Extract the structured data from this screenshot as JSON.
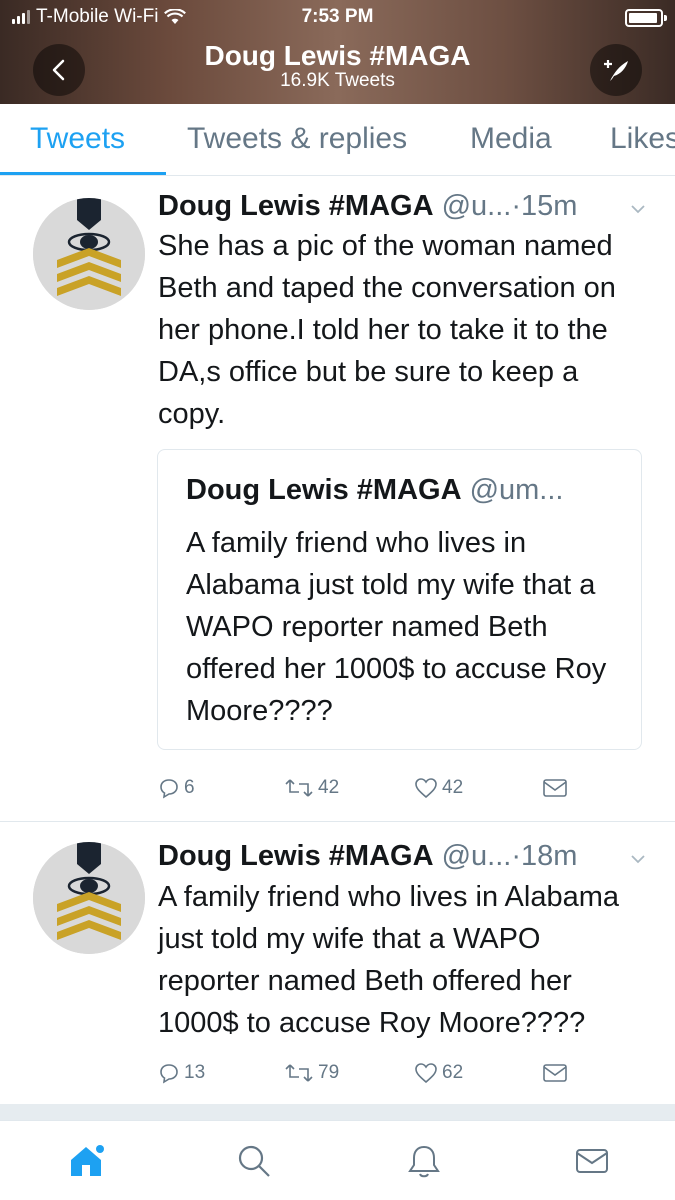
{
  "status_bar": {
    "carrier": "T-Mobile Wi-Fi",
    "time": "7:53 PM"
  },
  "header": {
    "title": "Doug Lewis #MAGA",
    "subtitle": "16.9K Tweets"
  },
  "tabs": [
    {
      "label": "Tweets",
      "active": true
    },
    {
      "label": "Tweets & replies",
      "active": false
    },
    {
      "label": "Media",
      "active": false
    },
    {
      "label": "Likes",
      "active": false
    }
  ],
  "tweets": [
    {
      "name": "Doug Lewis #MAGA",
      "handle": "@u...",
      "time": "15m",
      "text": "She has a pic of the woman named Beth and taped the conversation on her phone.I told her to take it to the DA,s office but be sure to keep a copy.",
      "quote": {
        "name": "Doug Lewis #MAGA",
        "handle": "@um...",
        "text": "A family friend who lives in Alabama  just told my wife that a WAPO reporter named Beth offered her 1000$ to accuse Roy Moore????"
      },
      "replies": "6",
      "retweets": "42",
      "likes": "42"
    },
    {
      "name": "Doug Lewis #MAGA",
      "handle": "@u...",
      "time": "18m",
      "text": "A family friend who lives in Alabama just told my wife that a WAPO reporter named Beth offered her 1000$ to accuse Roy Moore????",
      "replies": "13",
      "retweets": "79",
      "likes": "62"
    }
  ],
  "bottom_nav": [
    "home-icon",
    "search-icon",
    "notifications-icon",
    "messages-icon"
  ],
  "colors": {
    "accent": "#1da1f2",
    "secondary_text": "#657786",
    "divider": "#e1e8ed"
  }
}
